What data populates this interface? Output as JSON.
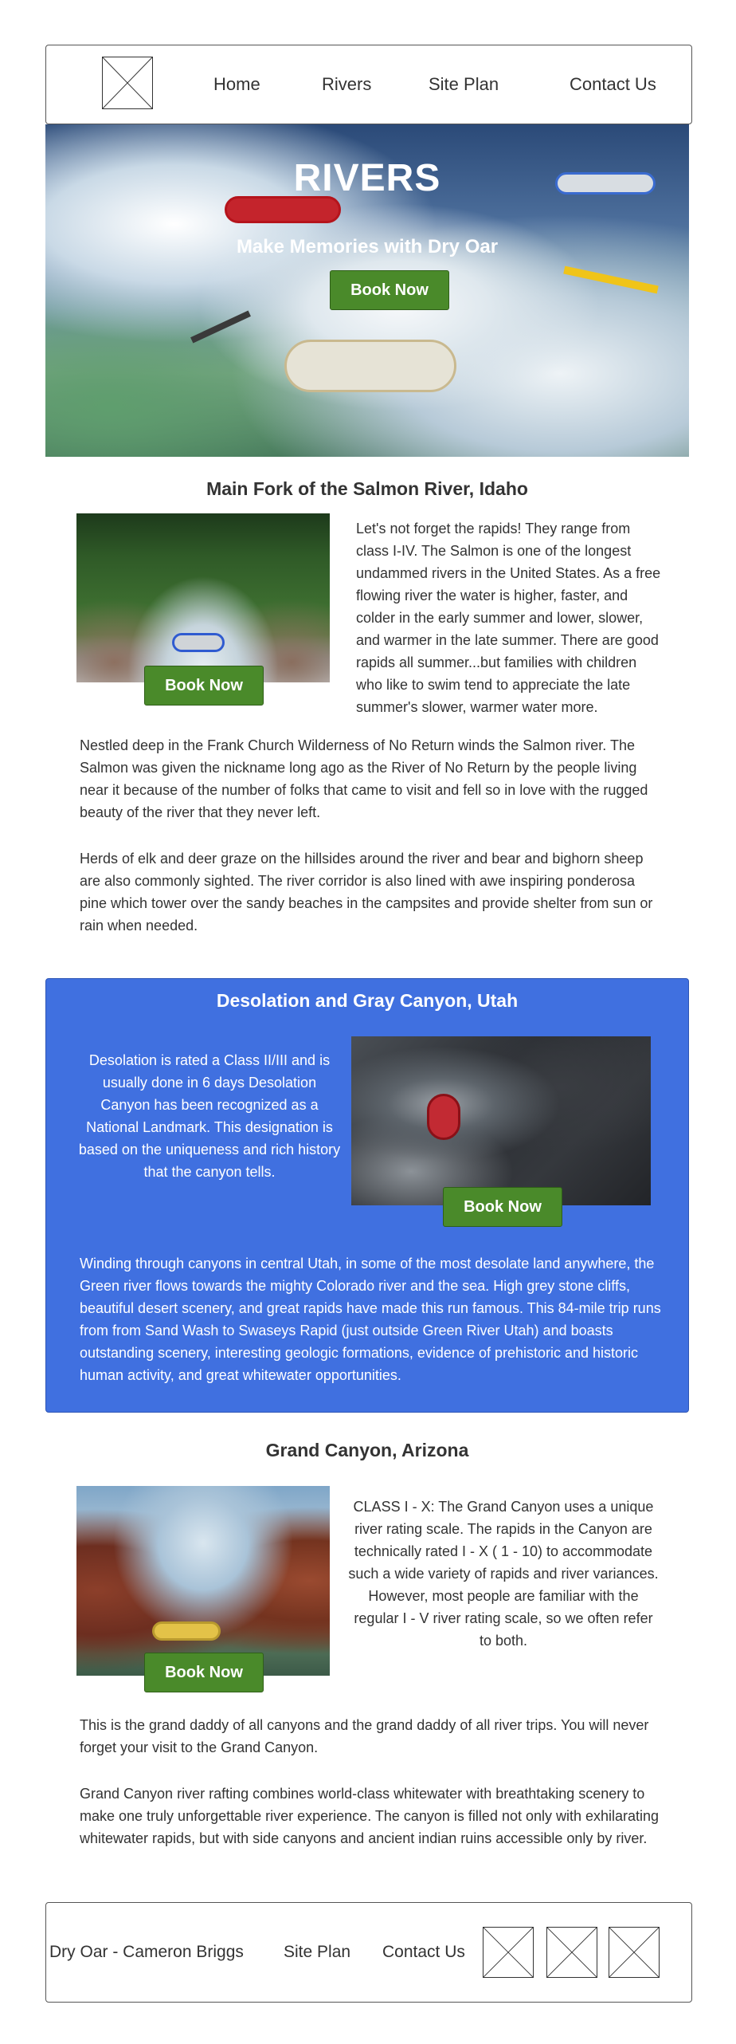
{
  "header": {
    "nav": [
      {
        "label": "Home"
      },
      {
        "label": "Rivers"
      },
      {
        "label": "Site Plan"
      },
      {
        "label": "Contact Us"
      }
    ]
  },
  "hero": {
    "title": "RIVERS",
    "subtitle": "Make Memories with Dry Oar",
    "button": "Book Now"
  },
  "salmon": {
    "title": "Main Fork of the Salmon River, Idaho",
    "button": "Book Now",
    "side_text": "Let's not forget the rapids! They range from class I-IV. The Salmon is one of the longest undammed rivers in the United States. As a free flowing river the water is higher, faster, and colder in the early summer and lower, slower, and warmer in the late summer. There are good rapids all summer...but families with children who like to swim tend to appreciate the late summer's slower, warmer water more.",
    "para1": "Nestled deep in the Frank Church Wilderness of No Return winds the Salmon river. The Salmon was given the nickname long ago as the River of No Return by the people living near it because of the number of folks that came to visit and fell so in love with the rugged beauty of the river that they never left.",
    "para2": "Herds of elk and deer graze on the hillsides around the river and bear and bighorn sheep are also commonly sighted. The river corridor is also lined with awe inspiring ponderosa pine which tower over the sandy beaches in the campsites and provide shelter from sun or rain when needed."
  },
  "desolation": {
    "title": "Desolation and Gray Canyon, Utah",
    "button": "Book Now",
    "side_text": "Desolation is rated a Class II/III and is usually done in 6 days Desolation Canyon has been recognized as a National Landmark. This designation is based on the uniqueness and rich history that the canyon tells.",
    "para": "Winding through canyons in central Utah, in some of the most desolate land anywhere, the Green river flows towards the mighty Colorado river and the sea. High grey stone cliffs, beautiful desert scenery, and great rapids have made this run famous. This 84-mile trip runs from from Sand Wash to Swaseys Rapid (just outside Green River Utah) and boasts outstanding scenery, interesting geologic formations, evidence of prehistoric and historic human activity, and great whitewater opportunities."
  },
  "grand": {
    "title": "Grand Canyon, Arizona",
    "button": "Book Now",
    "side_text": "CLASS I - X: The Grand Canyon uses a unique river rating scale. The rapids in the Canyon are technically rated I - X ( 1 - 10) to accommodate such a wide variety of rapids and river variances. However, most people are familiar with the regular I - V river rating scale, so we often refer to both.",
    "para1": "This is the grand daddy of all canyons and the grand daddy of all river trips. You will never forget your visit to the Grand Canyon.",
    "para2": "Grand Canyon river rafting combines world-class whitewater with breathtaking scenery to make one truly unforgettable river experience. The canyon is filled not only with exhilarating whitewater rapids, but with side canyons and ancient indian ruins accessible only by river."
  },
  "footer": {
    "brand": "Dry Oar - Cameron Briggs",
    "site_plan": "Site Plan",
    "contact": "Contact Us"
  },
  "colors": {
    "button": "#4a8a2a",
    "blue_section": "#4070e0"
  }
}
